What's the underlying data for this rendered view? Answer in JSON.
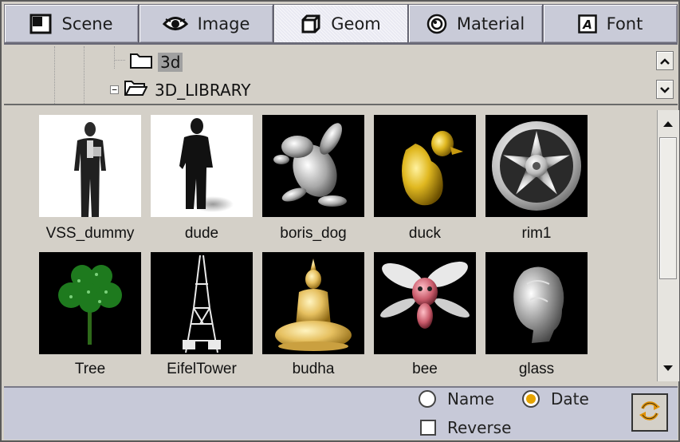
{
  "tabs": [
    {
      "label": "Scene",
      "icon": "scene-icon"
    },
    {
      "label": "Image",
      "icon": "eye-icon"
    },
    {
      "label": "Geom",
      "icon": "geom-icon",
      "active": true
    },
    {
      "label": "Material",
      "icon": "material-icon"
    },
    {
      "label": "Font",
      "icon": "font-icon"
    }
  ],
  "tree": {
    "items": [
      {
        "label": "3d",
        "selected": true
      },
      {
        "label": "3D_LIBRARY",
        "expander": "−"
      }
    ]
  },
  "library": {
    "items": [
      {
        "name": "VSS_dummy"
      },
      {
        "name": "dude"
      },
      {
        "name": "boris_dog"
      },
      {
        "name": "duck"
      },
      {
        "name": "rim1"
      },
      {
        "name": "Tree"
      },
      {
        "name": "EifelTower"
      },
      {
        "name": "budha"
      },
      {
        "name": "bee"
      },
      {
        "name": "glass"
      }
    ]
  },
  "sort": {
    "name_label": "Name",
    "date_label": "Date",
    "reverse_label": "Reverse",
    "selected": "Date",
    "reverse_checked": false
  },
  "colors": {
    "accent": "#e6a400"
  }
}
